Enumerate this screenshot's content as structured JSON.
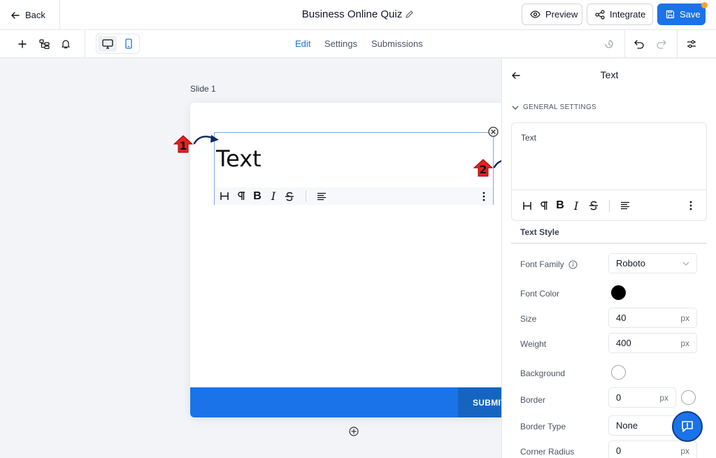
{
  "header": {
    "back_label": "Back",
    "title": "Business Online Quiz",
    "preview_label": "Preview",
    "integrate_label": "Integrate",
    "save_label": "Save",
    "accent_color": "#1a73e8"
  },
  "toolbar": {
    "tabs": [
      {
        "label": "Edit",
        "active": true
      },
      {
        "label": "Settings",
        "active": false
      },
      {
        "label": "Submissions",
        "active": false
      }
    ],
    "left_icons": [
      "plus-icon",
      "structure-icon",
      "bell-icon"
    ],
    "device_toggle": [
      "desktop-icon",
      "mobile-icon"
    ],
    "right_icons": [
      "history-icon",
      "undo-icon",
      "redo-icon",
      "sliders-icon"
    ]
  },
  "canvas": {
    "slide_label": "Slide 1",
    "text_block": "Text",
    "submit_label": "SUBMIT",
    "annotations": [
      "1",
      "2"
    ]
  },
  "panel": {
    "title": "Text",
    "general_settings": "GENERAL SETTINGS",
    "editor_text": "Text",
    "text_style_title": "Text Style",
    "font_family": {
      "label": "Font Family",
      "value": "Roboto"
    },
    "font_color": {
      "label": "Font Color",
      "value": "#000000"
    },
    "size": {
      "label": "Size",
      "value": "40",
      "unit": "px"
    },
    "weight": {
      "label": "Weight",
      "value": "400",
      "unit": "px"
    },
    "background": {
      "label": "Background",
      "value": "#ffffff"
    },
    "border": {
      "label": "Border",
      "value": "0",
      "unit": "px"
    },
    "border_type": {
      "label": "Border Type",
      "value": "None"
    },
    "corner_radius": {
      "label": "Corner Radius",
      "value": "0",
      "unit": "px"
    }
  }
}
